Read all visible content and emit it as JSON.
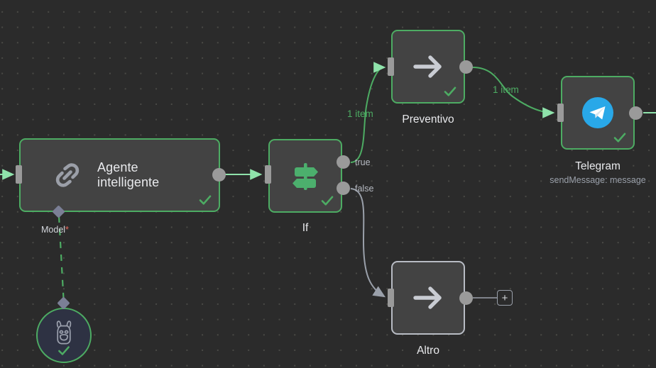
{
  "canvas": {
    "background_color": "#2b2b2b",
    "grid_dot_color": "#4a4a46",
    "accent_success": "#4dac63",
    "node_fill": "#434343",
    "idle_border": "#b8bcc4",
    "telegram_blue": "#29a8e8"
  },
  "nodes": [
    {
      "id": "agent",
      "title_line1": "Agente",
      "title_line2": "intelligente",
      "icon": "chain-link-icon",
      "status": "success",
      "sub_connector_label": "Model",
      "sub_connector_required": "*"
    },
    {
      "id": "if",
      "caption": "If",
      "icon": "signpost-icon",
      "status": "success",
      "output_labels": [
        "true",
        "false"
      ]
    },
    {
      "id": "preventivo",
      "caption": "Preventivo",
      "icon": "arrow-right-icon",
      "status": "success"
    },
    {
      "id": "telegram",
      "caption": "Telegram",
      "subcaption": "sendMessage: message",
      "icon": "telegram-icon",
      "status": "success"
    },
    {
      "id": "altro",
      "caption": "Altro",
      "icon": "arrow-right-icon",
      "status": "idle"
    },
    {
      "id": "model",
      "icon": "llama-icon",
      "status": "success"
    }
  ],
  "edges": [
    {
      "id": "if-true-preventivo",
      "label": "1 item",
      "color": "#4dac63"
    },
    {
      "id": "preventivo-telegram",
      "label": "1 item",
      "color": "#4dac63"
    },
    {
      "id": "if-false-altro",
      "label": "",
      "color": "#9aa0aa"
    }
  ],
  "labels": {
    "true": "true",
    "false": "false",
    "item_count_a": "1 item",
    "item_count_b": "1 item",
    "model_label": "Model",
    "required_marker": "*",
    "add_node_plus": "+"
  },
  "captions": {
    "agent_line1": "Agente",
    "agent_line2": "intelligente",
    "if": "If",
    "preventivo": "Preventivo",
    "telegram": "Telegram",
    "telegram_sub": "sendMessage: message",
    "altro": "Altro"
  }
}
